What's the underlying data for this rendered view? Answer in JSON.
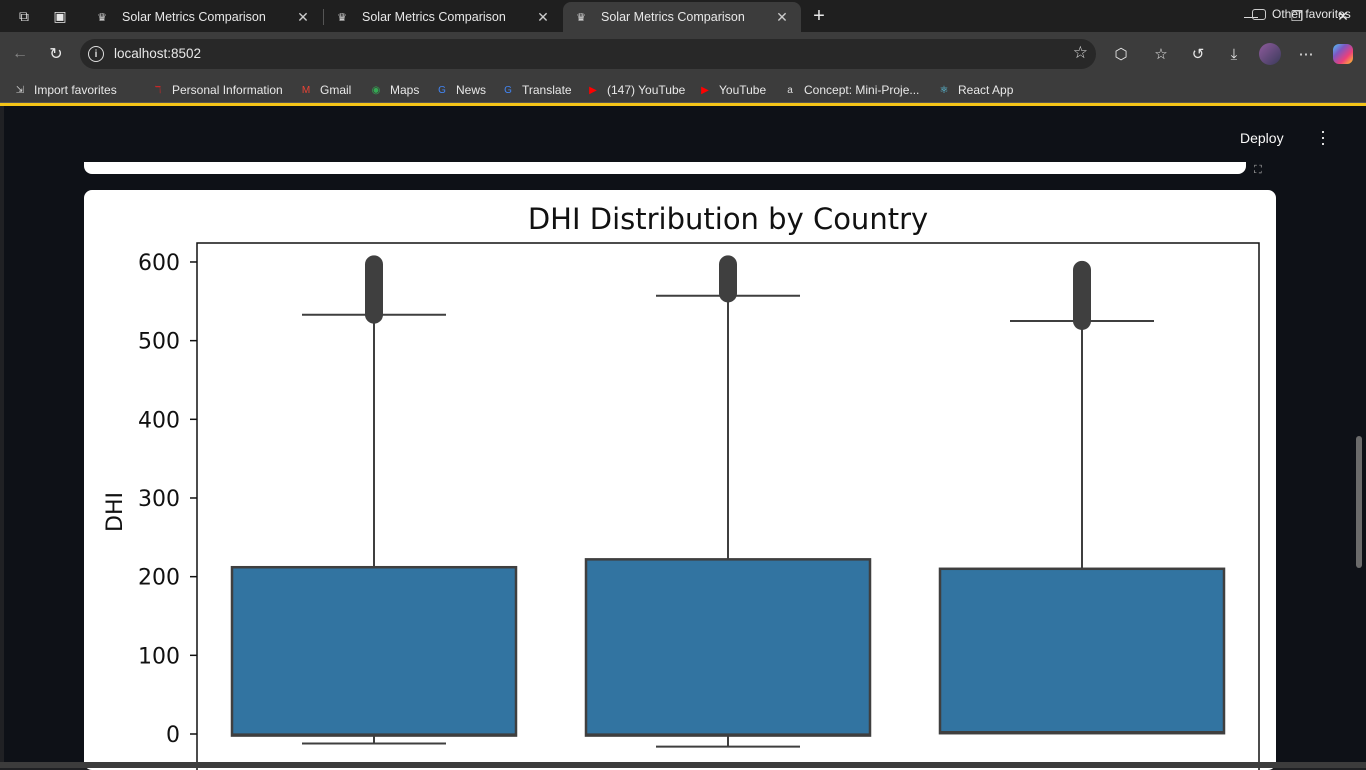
{
  "browser": {
    "tabs": [
      {
        "title": "Solar Metrics Comparison",
        "active": false
      },
      {
        "title": "Solar Metrics Comparison",
        "active": false
      },
      {
        "title": "Solar Metrics Comparison",
        "active": true
      }
    ],
    "url": "localhost:8502",
    "bookmarks": [
      {
        "label": "Import favorites",
        "icon": "import-icon",
        "color": "#cccccc"
      },
      {
        "label": "Personal Information",
        "icon": "bookmark-app-icon",
        "color": "#c62828"
      },
      {
        "label": "Gmail",
        "icon": "gmail-icon",
        "color": "#ea4335"
      },
      {
        "label": "Maps",
        "icon": "maps-icon",
        "color": "#34a853"
      },
      {
        "label": "News",
        "icon": "news-icon",
        "color": "#4285f4"
      },
      {
        "label": "Translate",
        "icon": "translate-icon",
        "color": "#4285f4"
      },
      {
        "label": "(147) YouTube",
        "icon": "youtube-icon",
        "color": "#ff0000"
      },
      {
        "label": "YouTube",
        "icon": "youtube-icon",
        "color": "#ff0000"
      },
      {
        "label": "Concept: Mini-Proje...",
        "icon": "alx-icon",
        "color": "#dddddd"
      },
      {
        "label": "React App",
        "icon": "react-icon",
        "color": "#61dafb"
      }
    ],
    "other_favorites": "Other favorites"
  },
  "app": {
    "deploy_label": "Deploy",
    "accent": "#f5c518"
  },
  "chart_data": {
    "type": "box",
    "title": "DHI Distribution by Country",
    "xlabel": "",
    "ylabel": "DHI",
    "yticks": [
      0,
      100,
      200,
      300,
      400,
      500,
      600
    ],
    "color": "#3274a1",
    "boxes": [
      {
        "whisker_low": -12,
        "q1": -2,
        "q3": 212,
        "whisker_high": 533,
        "outliers_min": 533,
        "outliers_max": 597
      },
      {
        "whisker_low": -16,
        "q1": -2,
        "q3": 222,
        "whisker_high": 557,
        "outliers_min": 560,
        "outliers_max": 597
      },
      {
        "whisker_low": 2,
        "q1": 1,
        "q3": 210,
        "whisker_high": 525,
        "outliers_min": 525,
        "outliers_max": 590
      }
    ]
  }
}
